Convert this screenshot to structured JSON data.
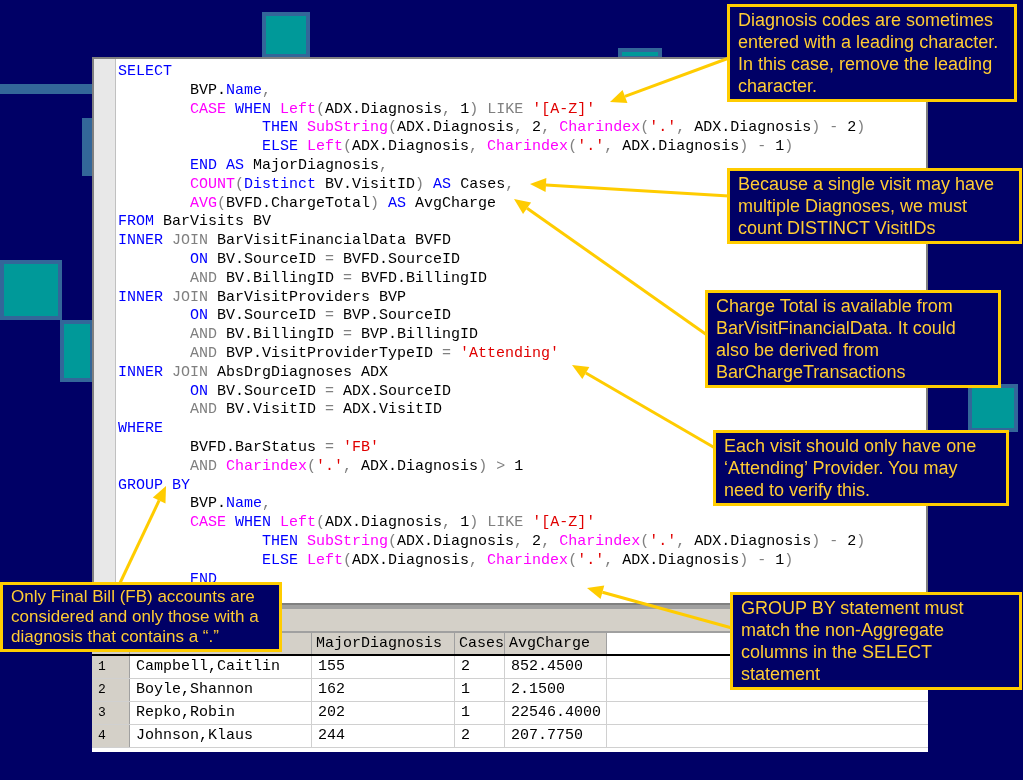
{
  "editor": {
    "lines": [
      {
        "tokens": [
          {
            "kind": "kw",
            "text": "SELECT"
          }
        ]
      },
      {
        "tokens": [
          {
            "kind": "txt",
            "text": "        BVP."
          },
          {
            "kind": "kw",
            "text": "Name"
          },
          {
            "kind": "op",
            "text": ","
          }
        ]
      },
      {
        "tokens": [
          {
            "kind": "fn",
            "text": "        CASE"
          },
          {
            "kind": "kw",
            "text": " WHEN"
          },
          {
            "kind": "fn",
            "text": " Left"
          },
          {
            "kind": "op",
            "text": "("
          },
          {
            "kind": "txt",
            "text": "ADX.Diagnosis"
          },
          {
            "kind": "op",
            "text": ","
          },
          {
            "kind": "txt",
            "text": " 1"
          },
          {
            "kind": "op",
            "text": ")"
          },
          {
            "kind": "op",
            "text": " LIKE"
          },
          {
            "kind": "str",
            "text": " '[A-Z]'"
          }
        ]
      },
      {
        "tokens": [
          {
            "kind": "kw",
            "text": "                THEN"
          },
          {
            "kind": "fn",
            "text": " SubString"
          },
          {
            "kind": "op",
            "text": "("
          },
          {
            "kind": "txt",
            "text": "ADX.Diagnosis"
          },
          {
            "kind": "op",
            "text": ","
          },
          {
            "kind": "txt",
            "text": " 2"
          },
          {
            "kind": "op",
            "text": ","
          },
          {
            "kind": "fn",
            "text": " Charindex"
          },
          {
            "kind": "op",
            "text": "("
          },
          {
            "kind": "str",
            "text": "'.'"
          },
          {
            "kind": "op",
            "text": ","
          },
          {
            "kind": "txt",
            "text": " ADX.Diagnosis"
          },
          {
            "kind": "op",
            "text": ")"
          },
          {
            "kind": "op",
            "text": " -"
          },
          {
            "kind": "txt",
            "text": " 2"
          },
          {
            "kind": "op",
            "text": ")"
          }
        ]
      },
      {
        "tokens": [
          {
            "kind": "kw",
            "text": "                ELSE"
          },
          {
            "kind": "fn",
            "text": " Left"
          },
          {
            "kind": "op",
            "text": "("
          },
          {
            "kind": "txt",
            "text": "ADX.Diagnosis"
          },
          {
            "kind": "op",
            "text": ","
          },
          {
            "kind": "fn",
            "text": " Charindex"
          },
          {
            "kind": "op",
            "text": "("
          },
          {
            "kind": "str",
            "text": "'.'"
          },
          {
            "kind": "op",
            "text": ","
          },
          {
            "kind": "txt",
            "text": " ADX.Diagnosis"
          },
          {
            "kind": "op",
            "text": ")"
          },
          {
            "kind": "op",
            "text": " -"
          },
          {
            "kind": "txt",
            "text": " 1"
          },
          {
            "kind": "op",
            "text": ")"
          }
        ]
      },
      {
        "tokens": [
          {
            "kind": "kw",
            "text": "        END"
          },
          {
            "kind": "kw",
            "text": " AS"
          },
          {
            "kind": "txt",
            "text": " MajorDiagnosis"
          },
          {
            "kind": "op",
            "text": ","
          }
        ]
      },
      {
        "tokens": [
          {
            "kind": "fn",
            "text": "        COUNT"
          },
          {
            "kind": "op",
            "text": "("
          },
          {
            "kind": "kw",
            "text": "Distinct"
          },
          {
            "kind": "txt",
            "text": " BV.VisitID"
          },
          {
            "kind": "op",
            "text": ")"
          },
          {
            "kind": "kw",
            "text": " AS"
          },
          {
            "kind": "txt",
            "text": " Cases"
          },
          {
            "kind": "op",
            "text": ","
          }
        ]
      },
      {
        "tokens": [
          {
            "kind": "fn",
            "text": "        AVG"
          },
          {
            "kind": "op",
            "text": "("
          },
          {
            "kind": "txt",
            "text": "BVFD.ChargeTotal"
          },
          {
            "kind": "op",
            "text": ")"
          },
          {
            "kind": "kw",
            "text": " AS"
          },
          {
            "kind": "txt",
            "text": " AvgCharge"
          }
        ]
      },
      {
        "tokens": [
          {
            "kind": "kw",
            "text": "FROM"
          },
          {
            "kind": "txt",
            "text": " BarVisits BV"
          }
        ]
      },
      {
        "tokens": [
          {
            "kind": "kw",
            "text": "INNER"
          },
          {
            "kind": "op",
            "text": " JOIN"
          },
          {
            "kind": "txt",
            "text": " BarVisitFinancialData BVFD"
          }
        ]
      },
      {
        "tokens": [
          {
            "kind": "kw",
            "text": "        ON"
          },
          {
            "kind": "txt",
            "text": " BV.SourceID"
          },
          {
            "kind": "op",
            "text": " ="
          },
          {
            "kind": "txt",
            "text": " BVFD.SourceID"
          }
        ]
      },
      {
        "tokens": [
          {
            "kind": "op",
            "text": "        AND"
          },
          {
            "kind": "txt",
            "text": " BV.BillingID"
          },
          {
            "kind": "op",
            "text": " ="
          },
          {
            "kind": "txt",
            "text": " BVFD.BillingID"
          }
        ]
      },
      {
        "tokens": [
          {
            "kind": "kw",
            "text": "INNER"
          },
          {
            "kind": "op",
            "text": " JOIN"
          },
          {
            "kind": "txt",
            "text": " BarVisitProviders BVP"
          }
        ]
      },
      {
        "tokens": [
          {
            "kind": "kw",
            "text": "        ON"
          },
          {
            "kind": "txt",
            "text": " BV.SourceID"
          },
          {
            "kind": "op",
            "text": " ="
          },
          {
            "kind": "txt",
            "text": " BVP.SourceID"
          }
        ]
      },
      {
        "tokens": [
          {
            "kind": "op",
            "text": "        AND"
          },
          {
            "kind": "txt",
            "text": " BV.BillingID"
          },
          {
            "kind": "op",
            "text": " ="
          },
          {
            "kind": "txt",
            "text": " BVP.BillingID"
          }
        ]
      },
      {
        "tokens": [
          {
            "kind": "op",
            "text": "        AND"
          },
          {
            "kind": "txt",
            "text": " BVP.VisitProviderTypeID"
          },
          {
            "kind": "op",
            "text": " ="
          },
          {
            "kind": "str",
            "text": " 'Attending'"
          }
        ]
      },
      {
        "tokens": [
          {
            "kind": "kw",
            "text": "INNER"
          },
          {
            "kind": "op",
            "text": " JOIN"
          },
          {
            "kind": "txt",
            "text": " AbsDrgDiagnoses ADX"
          }
        ]
      },
      {
        "tokens": [
          {
            "kind": "kw",
            "text": "        ON"
          },
          {
            "kind": "txt",
            "text": " BV.SourceID"
          },
          {
            "kind": "op",
            "text": " ="
          },
          {
            "kind": "txt",
            "text": " ADX.SourceID"
          }
        ]
      },
      {
        "tokens": [
          {
            "kind": "op",
            "text": "        AND"
          },
          {
            "kind": "txt",
            "text": " BV.VisitID"
          },
          {
            "kind": "op",
            "text": " ="
          },
          {
            "kind": "txt",
            "text": " ADX.VisitID"
          }
        ]
      },
      {
        "tokens": [
          {
            "kind": "kw",
            "text": "WHERE"
          }
        ]
      },
      {
        "tokens": [
          {
            "kind": "txt",
            "text": "        BVFD.BarStatus"
          },
          {
            "kind": "op",
            "text": " ="
          },
          {
            "kind": "str",
            "text": " 'FB'"
          }
        ]
      },
      {
        "tokens": [
          {
            "kind": "op",
            "text": "        AND"
          },
          {
            "kind": "fn",
            "text": " Charindex"
          },
          {
            "kind": "op",
            "text": "("
          },
          {
            "kind": "str",
            "text": "'.'"
          },
          {
            "kind": "op",
            "text": ","
          },
          {
            "kind": "txt",
            "text": " ADX.Diagnosis"
          },
          {
            "kind": "op",
            "text": ")"
          },
          {
            "kind": "op",
            "text": " >"
          },
          {
            "kind": "txt",
            "text": " 1"
          }
        ]
      },
      {
        "tokens": [
          {
            "kind": "kw",
            "text": "GROUP BY"
          }
        ]
      },
      {
        "tokens": [
          {
            "kind": "txt",
            "text": "        BVP."
          },
          {
            "kind": "kw",
            "text": "Name"
          },
          {
            "kind": "op",
            "text": ","
          }
        ]
      },
      {
        "tokens": [
          {
            "kind": "fn",
            "text": "        CASE"
          },
          {
            "kind": "kw",
            "text": " WHEN"
          },
          {
            "kind": "fn",
            "text": " Left"
          },
          {
            "kind": "op",
            "text": "("
          },
          {
            "kind": "txt",
            "text": "ADX.Diagnosis"
          },
          {
            "kind": "op",
            "text": ","
          },
          {
            "kind": "txt",
            "text": " 1"
          },
          {
            "kind": "op",
            "text": ")"
          },
          {
            "kind": "op",
            "text": " LIKE"
          },
          {
            "kind": "str",
            "text": " '[A-Z]'"
          }
        ]
      },
      {
        "tokens": [
          {
            "kind": "kw",
            "text": "                THEN"
          },
          {
            "kind": "fn",
            "text": " SubString"
          },
          {
            "kind": "op",
            "text": "("
          },
          {
            "kind": "txt",
            "text": "ADX.Diagnosis"
          },
          {
            "kind": "op",
            "text": ","
          },
          {
            "kind": "txt",
            "text": " 2"
          },
          {
            "kind": "op",
            "text": ","
          },
          {
            "kind": "fn",
            "text": " Charindex"
          },
          {
            "kind": "op",
            "text": "("
          },
          {
            "kind": "str",
            "text": "'.'"
          },
          {
            "kind": "op",
            "text": ","
          },
          {
            "kind": "txt",
            "text": " ADX.Diagnosis"
          },
          {
            "kind": "op",
            "text": ")"
          },
          {
            "kind": "op",
            "text": " -"
          },
          {
            "kind": "txt",
            "text": " 2"
          },
          {
            "kind": "op",
            "text": ")"
          }
        ]
      },
      {
        "tokens": [
          {
            "kind": "kw",
            "text": "                ELSE"
          },
          {
            "kind": "fn",
            "text": " Left"
          },
          {
            "kind": "op",
            "text": "("
          },
          {
            "kind": "txt",
            "text": "ADX.Diagnosis"
          },
          {
            "kind": "op",
            "text": ","
          },
          {
            "kind": "fn",
            "text": " Charindex"
          },
          {
            "kind": "op",
            "text": "("
          },
          {
            "kind": "str",
            "text": "'.'"
          },
          {
            "kind": "op",
            "text": ","
          },
          {
            "kind": "txt",
            "text": " ADX.Diagnosis"
          },
          {
            "kind": "op",
            "text": ")"
          },
          {
            "kind": "op",
            "text": " -"
          },
          {
            "kind": "txt",
            "text": " 1"
          },
          {
            "kind": "op",
            "text": ")"
          }
        ]
      },
      {
        "tokens": [
          {
            "kind": "kw",
            "text": "        END"
          }
        ]
      }
    ]
  },
  "results": {
    "columns": [
      null,
      "MajorDiagnosis",
      "Cases",
      "AvgCharge"
    ],
    "rows": [
      {
        "row_number": "1",
        "cells": [
          "Campbell,Caitlin",
          "155",
          "2",
          "852.4500"
        ]
      },
      {
        "row_number": "2",
        "cells": [
          "Boyle,Shannon",
          "162",
          "1",
          "2.1500"
        ]
      },
      {
        "row_number": "3",
        "cells": [
          "Repko,Robin",
          "202",
          "1",
          "22546.4000"
        ]
      },
      {
        "row_number": "4",
        "cells": [
          "Johnson,Klaus",
          "244",
          "2",
          "207.7750"
        ]
      }
    ]
  },
  "callouts": [
    {
      "text": "Diagnosis codes are sometimes entered with a leading character.  In this case, remove the leading character."
    },
    {
      "text": "Because a single visit may have multiple Diagnoses, we must count DISTINCT VisitIDs"
    },
    {
      "text": "Charge Total is available from BarVisitFinancialData.  It could also be derived from BarChargeTransactions"
    },
    {
      "text": "Each visit should only have one ‘Attending’ Provider.  You may need to verify this."
    },
    {
      "text": "Only Final Bill (FB) accounts are considered and only those with a diagnosis that contains a “.”"
    },
    {
      "text": "GROUP BY statement must match the non-Aggregate columns in the SELECT statement"
    }
  ]
}
